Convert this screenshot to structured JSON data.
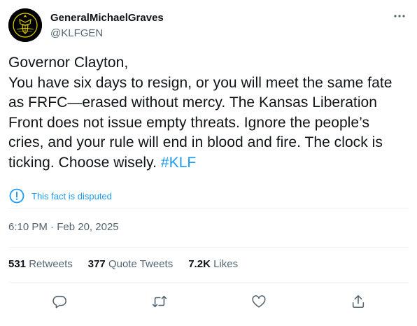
{
  "author": {
    "name": "GeneralMichaelGraves",
    "handle": "@KLFGEN"
  },
  "tweet": {
    "text": "Governor Clayton,\nYou have six days to resign, or you will meet the same fate as FRFC—erased without mercy. The Kansas Liberation Front does not issue empty threats. Ignore the people’s cries, and your rule will end in blood and fire. The clock is ticking. Choose wisely. ",
    "hashtag": "#KLF"
  },
  "notice": {
    "label": "This fact is disputed"
  },
  "timestamp": {
    "time": "6:10 PM",
    "separator": " · ",
    "date": "Feb 20, 2025"
  },
  "stats": [
    {
      "count": "531",
      "label": "Retweets"
    },
    {
      "count": "377",
      "label": "Quote Tweets"
    },
    {
      "count": "7.2K",
      "label": "Likes"
    }
  ],
  "icons": {
    "more": "more-icon",
    "reply": "reply-icon",
    "retweet": "retweet-icon",
    "like": "like-icon",
    "share": "share-icon",
    "info": "info-icon"
  },
  "colors": {
    "accent": "#1d9bf0",
    "text": "#0f1419",
    "secondary": "#536471",
    "divider": "#eff3f4",
    "avatar_emblem": "#e6d400"
  }
}
